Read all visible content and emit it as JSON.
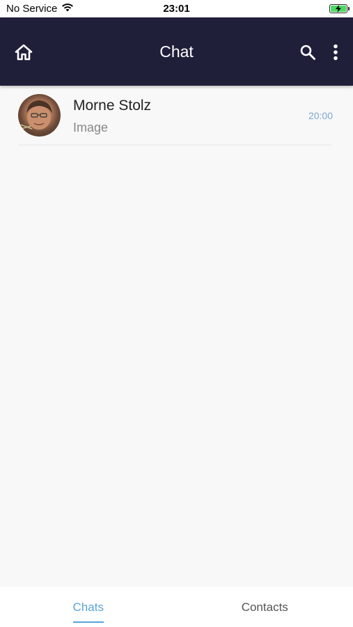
{
  "status_bar": {
    "carrier": "No Service",
    "time": "23:01"
  },
  "app_bar": {
    "title": "Chat",
    "background": "#1f1f3a"
  },
  "chats": [
    {
      "name": "Morne Stolz",
      "preview": "Image",
      "time": "20:00"
    }
  ],
  "tabs": [
    {
      "label": "Chats",
      "active": true
    },
    {
      "label": "Contacts",
      "active": false
    }
  ],
  "colors": {
    "accent": "#5aa3d8",
    "time_text": "#7fa7cf",
    "battery": "#4cd964"
  }
}
